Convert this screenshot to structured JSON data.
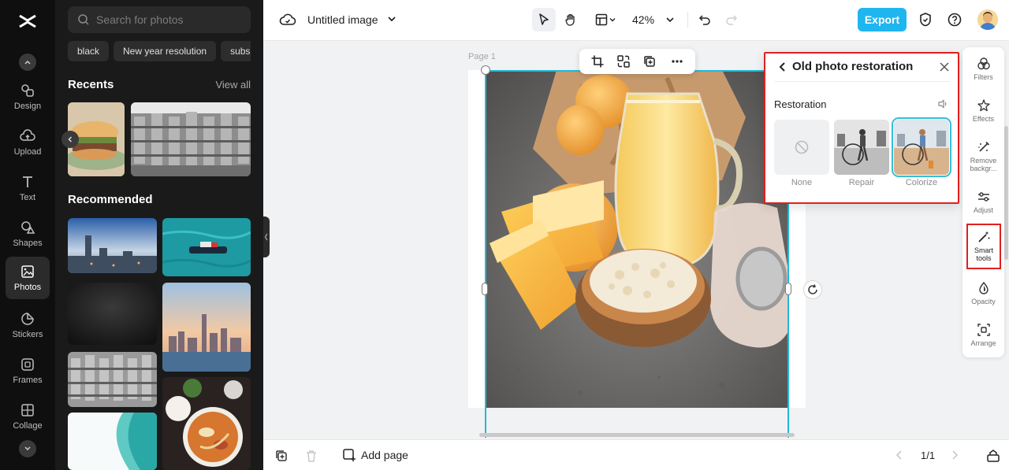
{
  "rail": {
    "items": [
      {
        "label": "Design"
      },
      {
        "label": "Upload"
      },
      {
        "label": "Text"
      },
      {
        "label": "Shapes"
      },
      {
        "label": "Photos"
      },
      {
        "label": "Stickers"
      },
      {
        "label": "Frames"
      },
      {
        "label": "Collage"
      }
    ],
    "active": "Photos"
  },
  "photos_panel": {
    "search_placeholder": "Search for photos",
    "chips": [
      "black",
      "New year resolution",
      "subs"
    ],
    "recents_title": "Recents",
    "view_all": "View all",
    "recommended_title": "Recommended"
  },
  "toolbar": {
    "title": "Untitled image",
    "zoom": "42%",
    "export": "Export"
  },
  "canvas": {
    "page_label": "Page 1"
  },
  "restoration": {
    "title": "Old photo restoration",
    "subtitle": "Restoration",
    "options": [
      {
        "label": "None"
      },
      {
        "label": "Repair"
      },
      {
        "label": "Colorize"
      }
    ],
    "selected": "Colorize"
  },
  "right_tools": [
    {
      "label": "Filters"
    },
    {
      "label": "Effects"
    },
    {
      "label": "Remove backgr..."
    },
    {
      "label": "Adjust"
    },
    {
      "label": "Smart tools"
    },
    {
      "label": "Opacity"
    },
    {
      "label": "Arrange"
    }
  ],
  "bottom": {
    "add_page": "Add page",
    "pager": "1/1"
  },
  "colors": {
    "accent": "#1fb6f0",
    "highlight": "#e0201f",
    "selection": "#23b8d6"
  }
}
